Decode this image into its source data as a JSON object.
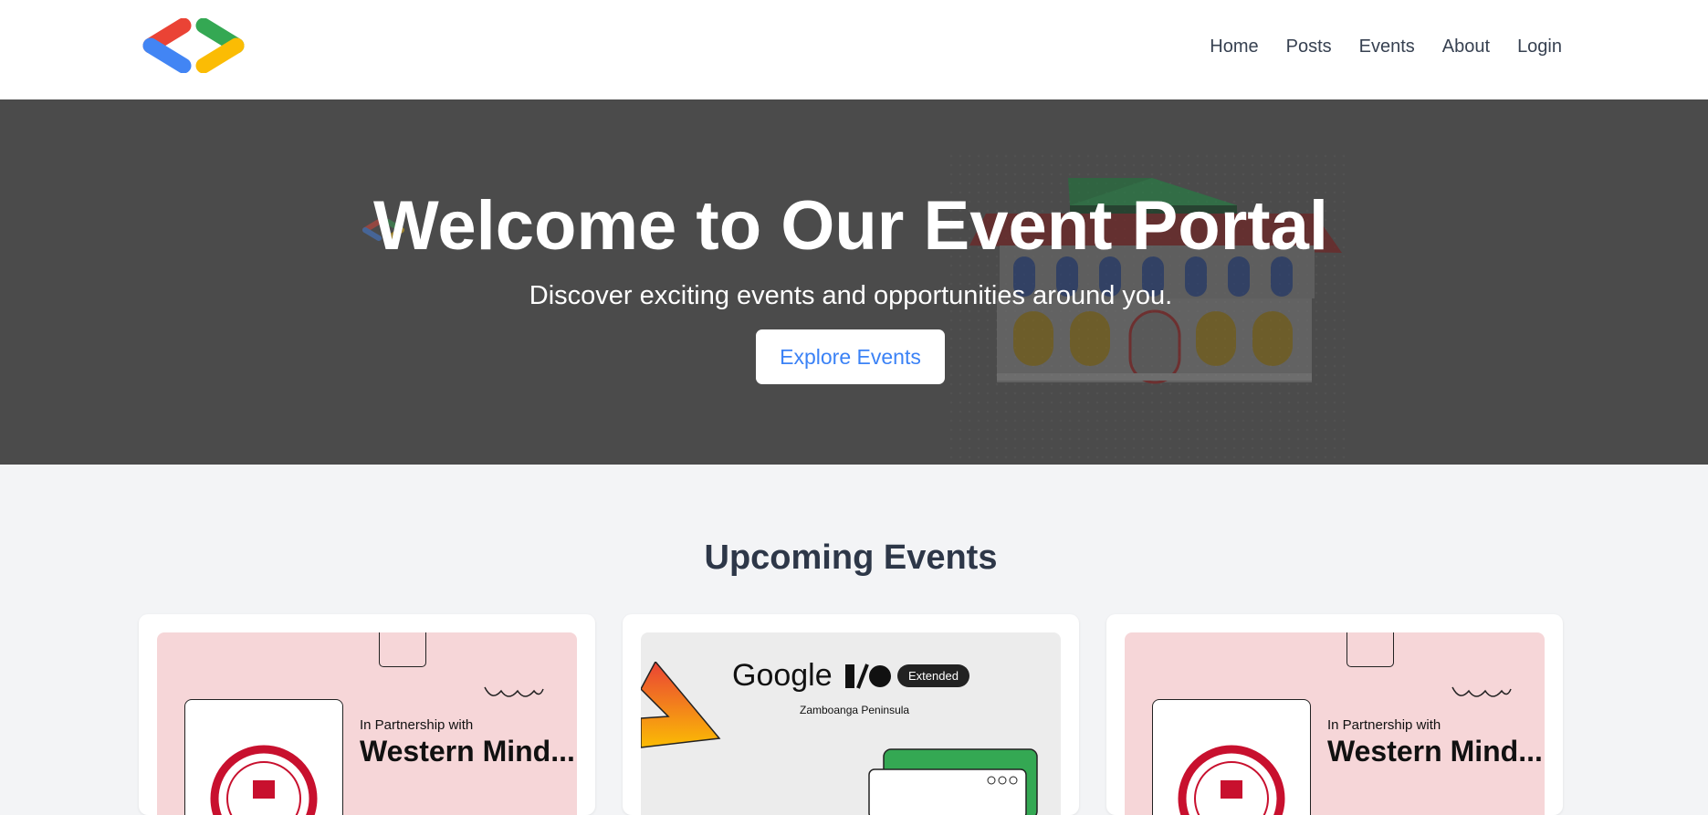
{
  "nav": {
    "links": [
      "Home",
      "Posts",
      "Events",
      "About",
      "Login"
    ]
  },
  "hero": {
    "title": "Welcome to Our Event Portal",
    "subtitle": "Discover exciting events and opportunities around you.",
    "button_label": "Explore Events"
  },
  "upcoming": {
    "title": "Upcoming Events",
    "cards": [
      {
        "partner_small": "In Partnership with",
        "partner_big": "Western Mind..."
      },
      {
        "google": "Google",
        "io": "I/O",
        "extended": "Extended",
        "location": "Zamboanga Peninsula"
      },
      {
        "partner_small": "In Partnership with",
        "partner_big": "Western Mind..."
      }
    ]
  },
  "colors": {
    "accent": "#3b82f6",
    "hero_bg": "#4b4b4b",
    "page_bg": "#f3f4f6",
    "logo_red": "#ea4335",
    "logo_blue": "#4285f4",
    "logo_green": "#34a853",
    "logo_yellow": "#fbbc04"
  }
}
